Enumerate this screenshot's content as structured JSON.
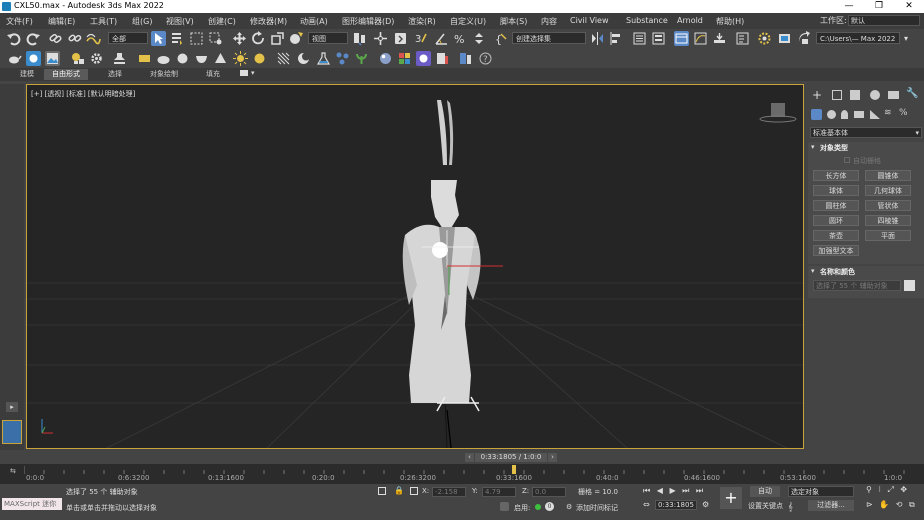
{
  "title": "CXL50.max - Autodesk 3ds Max 2022",
  "window_controls": {
    "minimize": "—",
    "maximize": "❐",
    "close": "✕"
  },
  "menu": [
    "文件(F)",
    "编辑(E)",
    "工具(T)",
    "组(G)",
    "视图(V)",
    "创建(C)",
    "修改器(M)",
    "动画(A)",
    "图形编辑器(D)",
    "渲染(R)",
    "自定义(U)",
    "脚本(S)",
    "内容",
    "Civil View",
    "Substance",
    "Arnold",
    "帮助(H)"
  ],
  "workspace": {
    "label": "工作区:",
    "value": "默认"
  },
  "toolbar": {
    "filter_value": "全部",
    "view_value": "视图",
    "selection_set_value": "创建选择集",
    "path_value": "C:\\Users\\— Max 2022"
  },
  "ribbon_tabs": [
    "建模",
    "自由形式",
    "选择",
    "对象绘制",
    "填充"
  ],
  "viewport": {
    "label": "[+] [透视] [标准] [默认明暗处理]"
  },
  "command_panel": {
    "category_value": "标准基本体",
    "rollout_object_type": "对象类型",
    "autogrid_label": "自动栅格",
    "object_buttons": [
      "长方体",
      "圆锥体",
      "球体",
      "几何球体",
      "圆柱体",
      "管状体",
      "圆环",
      "四棱锥",
      "茶壶",
      "平面",
      "加强型文本"
    ],
    "rollout_name_color": "名称和颜色",
    "name_value": "选择了 55 个 辅助对象"
  },
  "timeline": {
    "frame_slider": "0:33:1805 / 1:0:0",
    "ticks": [
      "0:0:0",
      "0:6:3200",
      "0:13:1600",
      "0:20:0",
      "0:26:3200",
      "0:33:1600",
      "0:40:0",
      "0:46:1600",
      "0:53:1600",
      "1:0:0"
    ]
  },
  "status": {
    "maxscript": "MAXScript 迷你",
    "selection_text": "选择了 55 个 辅助对象",
    "hint_text": "单击或单击并拖动以选择对象",
    "x_label": "X:",
    "x_value": "-2.158",
    "y_label": "Y:",
    "y_value": "4.79",
    "z_label": "Z:",
    "z_value": "0.0",
    "grid_text": "栅格 = 10.0",
    "enable_label": "启用:",
    "add_time_tag": "添加时间标记",
    "current_time": "0:33:1805",
    "auto_key": "自动",
    "set_key": "设置关键点",
    "key_mode_select": "选定对象",
    "key_filters": "过滤器..."
  }
}
